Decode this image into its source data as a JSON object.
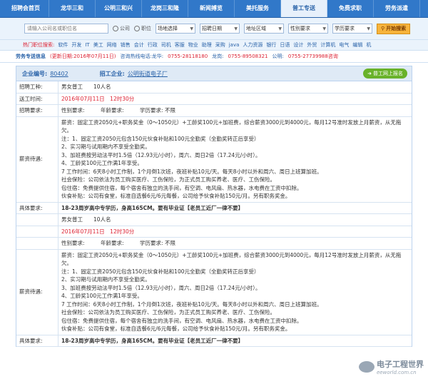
{
  "nav": [
    {
      "label": "招聘会首页",
      "active": false
    },
    {
      "label": "龙华三和",
      "active": false
    },
    {
      "label": "公明三和兴",
      "active": false
    },
    {
      "label": "龙岗三和隆",
      "active": false
    },
    {
      "label": "新闻搏览",
      "active": false
    },
    {
      "label": "美托服务",
      "active": false
    },
    {
      "label": "普工专送",
      "active": true
    },
    {
      "label": "免费求职",
      "active": false
    },
    {
      "label": "劳务派遣",
      "active": false
    }
  ],
  "search": {
    "placeholder": "请输入公司名或职位名",
    "radio_company": "公司",
    "radio_position": "职位",
    "sel_field": "场地选择",
    "sel_date": "招聘日期",
    "sel_area": "地址区域",
    "sel_gender": "性别要求",
    "sel_edu": "学历要求",
    "button": "开始搜索"
  },
  "hot": {
    "label": "热门职位搜索:",
    "items": [
      "软件",
      "开发",
      "IT",
      "美工",
      "网络",
      "销售",
      "会计",
      "行政",
      "司机",
      "客服",
      "物业",
      "助理",
      "采购",
      "java",
      "人力资源",
      "银行",
      "日语",
      "设计",
      "外贸",
      "计算机",
      "电气",
      "编辑",
      "机"
    ]
  },
  "contact": {
    "title": "劳务专送信息",
    "updated": "(更新日期:2016年07月11日)",
    "hotline": "咨询热线电话:龙华:",
    "phone1": "0755-28118180",
    "sep1": "龙岗:",
    "phone2": "0755-89508321",
    "sep2": "公明:",
    "phone3": "0755-27739988咨询"
  },
  "info": {
    "id_label": "企业编号:",
    "id_value": "80402",
    "company_label": "招工企业:",
    "company_value": "公明街道电子厂",
    "apply_label": "普工网上报名"
  },
  "job1": {
    "type_label": "招聘工种:",
    "type_value": "男女普工　　10人名",
    "date_label": "送工时间:",
    "date_value": "2016年07月11日　12时30分",
    "req_label": "招聘要求:",
    "req_value": "性别要求:　　　年龄要求:　　　学历要求: 不限",
    "salary_label": "薪资待遇:",
    "salary_lines": [
      "薪资：固定工资2050元+职务奖金（0～1050元）+工龄奖100元+加班费，综合薪资3000元到4000元，每月12号准时发放上月薪资，从无拖欠。",
      "注：1、固定工资2050元包含150元伙食补贴和100元全勤奖（全勤奖转正后享受）",
      "2、实习期与试用期内不享受全勤奖。",
      "3、加班费按劳动法平时1.5倍（12.93元/小时），周六、周日2倍（17.24元/小时）。",
      "4、工龄奖100元工作满1年享受。",
      "7 工作时间：6天8小时工作制，1个月倒1次班，夜班补贴10元/天。每天8小时以外和周六、周日上班算加班。",
      "社会保险：公司依法为员工购买医疗、工伤保险，为正式员工购买养老、医疗、工伤保险。",
      "包住宿：免费提供住宿，每个宿舍有独立的洗手间，有空调、电风扇、热水器，水电费在工资中扣除。",
      "伙食补贴：公司有食堂，标准自选餐6元/6元每餐，公司给予伙食补贴150元/月。另有职务奖金。"
    ],
    "detail_label": "具体要求:",
    "detail_value": "18-23周岁高中专学历，身高165CM。要有毕业证【老员工近厂一律不要】"
  },
  "job2": {
    "type_value": "男女普工　　10人名",
    "date_value": "2016年07月11日　12时30分",
    "req_value": "性别要求:　　　年龄要求:　　　学历要求: 不限",
    "salary_label": "薪资待遇:",
    "salary_lines": [
      "薪资：固定工资2050元+职务奖金（0～1050元）+工龄奖100元+加班费，综合薪资3000元到4000元，每月12号准时发放上月薪资，从无拖欠。",
      "注：1、固定工资2050元包含150元伙食补贴和100元全勤奖（全勤奖转正后享受）",
      "2、实习期与试用期内不享受全勤奖。",
      "3、加班费按劳动法平时1.5倍（12.93元/小时），周六、周日2倍（17.24元/小时）。",
      "4、工龄奖100元工作满1年享受。",
      "7 工作时间：6天8小时工作制，1个月倒1次班，夜班补贴10元/天。每天8小时以外和周六、周日上班算加班。",
      "社会保险：公司依法为员工购买医疗、工伤保险，为正式员工购买养老、医疗、工伤保险。",
      "包住宿：免费提供住宿，每个宿舍有独立的洗手间，有空调、电风扇、热水器，水电费在工资中扣除。",
      "伙食补贴：公司有食堂，标准自选餐6元/6元每餐，公司给予伙食补贴150元/月。另有职务奖金。"
    ],
    "detail_label": "具体要求:",
    "detail_value": "18-23周岁高中专学历，身高165CM。要有毕业证【老员工近厂一律不要】"
  },
  "watermark": {
    "name": "电子工程世界",
    "url": "eeworld.com.cn"
  }
}
